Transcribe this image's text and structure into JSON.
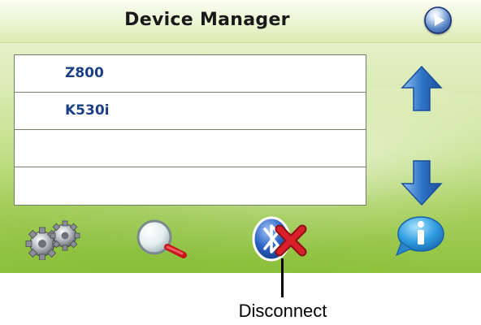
{
  "window": {
    "title": "Device Manager"
  },
  "device_list": {
    "rows": [
      {
        "label": "Z800"
      },
      {
        "label": "K530i"
      },
      {
        "label": ""
      },
      {
        "label": ""
      }
    ]
  },
  "icons": {
    "next": "play-circle-icon",
    "scroll_up": "arrow-up-icon",
    "scroll_down": "arrow-down-icon",
    "settings": "gears-icon",
    "search": "magnifier-icon",
    "disconnect": "bluetooth-disconnect-icon",
    "info": "info-bubble-icon"
  },
  "callout": {
    "label": "Disconnect"
  },
  "colors": {
    "background_green": "#a9d060",
    "list_text": "#1c3f86",
    "arrow_blue": "#2f74c8",
    "disconnect_red": "#d8202a"
  }
}
